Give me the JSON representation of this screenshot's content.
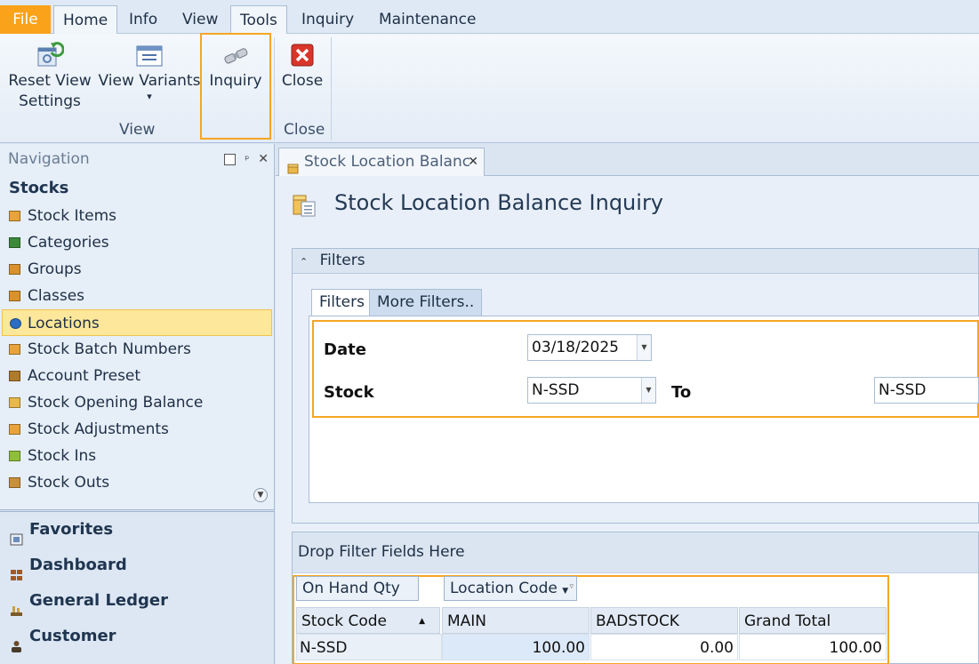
{
  "menu": {
    "tabs": [
      "File",
      "Home",
      "Info",
      "View",
      "Tools",
      "Inquiry",
      "Maintenance"
    ]
  },
  "ribbon": {
    "reset_view_settings": "Reset View Settings",
    "reset_line1": "Reset View",
    "reset_line2": "Settings",
    "view_variants": "View Variants",
    "view_variants_arrow": "▾",
    "inquiry": "Inquiry",
    "close": "Close",
    "group_view": "View",
    "group_close": "Close"
  },
  "navigation": {
    "header": "Navigation",
    "section": "Stocks",
    "items": [
      {
        "label": "Stock Items",
        "icon": "box-icon",
        "color": "#e8a33a"
      },
      {
        "label": "Categories",
        "icon": "hierarchy-icon",
        "color": "#3b8a3a"
      },
      {
        "label": "Groups",
        "icon": "boxes-icon",
        "color": "#d9922c"
      },
      {
        "label": "Classes",
        "icon": "boxes-icon",
        "color": "#d9922c"
      },
      {
        "label": "Locations",
        "icon": "globe-icon",
        "color": "#2b6fc2"
      },
      {
        "label": "Stock Batch Numbers",
        "icon": "box-icon",
        "color": "#e8a33a"
      },
      {
        "label": "Account Preset",
        "icon": "preset-icon",
        "color": "#b07a2a"
      },
      {
        "label": "Stock Opening Balance",
        "icon": "box-open-icon",
        "color": "#e8b84a"
      },
      {
        "label": "Stock Adjustments",
        "icon": "box-icon",
        "color": "#e8a33a"
      },
      {
        "label": "Stock Ins",
        "icon": "box-in-icon",
        "color": "#8fbf3a"
      },
      {
        "label": "Stock Outs",
        "icon": "box-out-icon",
        "color": "#c9903a"
      }
    ],
    "bottom": [
      {
        "label": "Favorites",
        "icon": "favorites-icon"
      },
      {
        "label": "Dashboard",
        "icon": "dashboard-icon"
      },
      {
        "label": "General Ledger",
        "icon": "ledger-icon"
      },
      {
        "label": "Customer",
        "icon": "customer-icon"
      }
    ]
  },
  "document": {
    "tab_label": "Stock Location Balance Inquiry",
    "tab_display": "Stock Location Balanc",
    "title": "Stock Location Balance Inquiry"
  },
  "filters": {
    "panel_title": "Filters",
    "tab_filters": "Filters",
    "tab_more": "More Filters..",
    "date_label": "Date",
    "date_value": "03/18/2025",
    "stock_label": "Stock",
    "stock_from": "N-SSD",
    "to_label": "To",
    "stock_to": "N-SSD"
  },
  "pivot": {
    "drop_area": "Drop Filter Fields Here",
    "data_field": "On Hand Qty",
    "column_field": "Location Code",
    "row_field": "Stock Code",
    "columns": [
      "MAIN",
      "BADSTOCK",
      "Grand Total"
    ],
    "rows": [
      {
        "code": "N-SSD",
        "values": [
          "100.00",
          "0.00",
          "100.00"
        ]
      }
    ]
  },
  "colors": {
    "highlight": "#f5a623",
    "file_tab": "#f9a21a",
    "selected_nav": "#fde79a"
  }
}
